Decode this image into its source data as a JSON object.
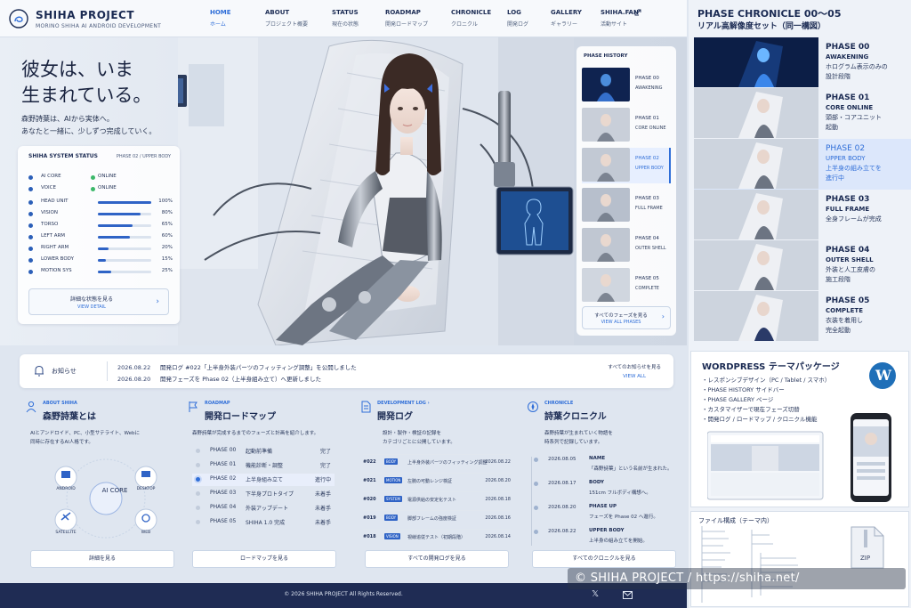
{
  "brand": {
    "name": "SHIHA PROJECT",
    "sub": "MORINO SHIHA AI ANDROID DEVELOPMENT"
  },
  "nav": [
    {
      "en": "HOME",
      "ja": "ホーム"
    },
    {
      "en": "ABOUT",
      "ja": "プロジェクト概要"
    },
    {
      "en": "STATUS",
      "ja": "現在の状態"
    },
    {
      "en": "ROADMAP",
      "ja": "開発ロードマップ"
    },
    {
      "en": "CHRONICLE",
      "ja": "クロニクル"
    },
    {
      "en": "LOG",
      "ja": "開発ログ"
    },
    {
      "en": "GALLERY",
      "ja": "ギャラリー"
    },
    {
      "en": "SHIHA.FAN",
      "ja": "活動サイト"
    }
  ],
  "hero": {
    "headline": "彼女は、いま\n生まれている。",
    "sub": "森野詩葉は、AIから実体へ。\nあなたと一緒に、少しずつ完成していく。"
  },
  "status": {
    "title": "SHIHA SYSTEM STATUS",
    "phase": "PHASE 02 / UPPER BODY",
    "online_rows": [
      {
        "name": "AI CORE",
        "value": "ONLINE"
      },
      {
        "name": "VOICE",
        "value": "ONLINE"
      }
    ],
    "rows": [
      {
        "name": "HEAD UNIT",
        "value": 100,
        "label": "100%"
      },
      {
        "name": "VISION",
        "value": 80,
        "label": "80%"
      },
      {
        "name": "TORSO",
        "value": 65,
        "label": "65%"
      },
      {
        "name": "LEFT ARM",
        "value": 60,
        "label": "60%"
      },
      {
        "name": "RIGHT ARM",
        "value": 20,
        "label": "20%"
      },
      {
        "name": "LOWER BODY",
        "value": 15,
        "label": "15%"
      },
      {
        "name": "MOTION SYS",
        "value": 25,
        "label": "25%"
      }
    ],
    "btn_ja": "詳細な状態を見る",
    "btn_en": "VIEW DETAIL"
  },
  "phase_history": {
    "title": "PHASE HISTORY",
    "items": [
      {
        "p": "PHASE 00",
        "n": "AWAKENING"
      },
      {
        "p": "PHASE 01",
        "n": "CORE ONLINE"
      },
      {
        "p": "PHASE 02",
        "n": "UPPER BODY"
      },
      {
        "p": "PHASE 03",
        "n": "FULL FRAME"
      },
      {
        "p": "PHASE 04",
        "n": "OUTER SHELL"
      },
      {
        "p": "PHASE 05",
        "n": "COMPLETE"
      }
    ],
    "btn_ja": "すべてのフェーズを見る",
    "btn_en": "VIEW ALL PHASES"
  },
  "notice": {
    "label": "お知らせ",
    "items": [
      {
        "date": "2026.08.22",
        "text": "開発ログ #022「上半身外装パーツのフィッティング調整」を公開しました"
      },
      {
        "date": "2026.08.20",
        "text": "開発フェーズを Phase 02（上半身組み立て）へ更新しました"
      }
    ],
    "all_ja": "すべてのお知らせを見る",
    "all_en": "VIEW ALL"
  },
  "about": {
    "en": "ABOUT SHIHA",
    "ja": "森野詩葉とは",
    "desc": "AIとアンドロイド、PC、小型サテライト、Webに\n同時に存在するAI人格です。",
    "core": "AI CORE",
    "nodes": [
      "ANDROID",
      "DESKTOP",
      "SATELLITE",
      "WEB"
    ],
    "btn": "詳細を見る"
  },
  "roadmap": {
    "en": "ROADMAP",
    "ja": "開発ロードマップ",
    "desc": "森野詩葉が完成するまでのフェーズと計画を紹介します。",
    "rows": [
      {
        "p": "PHASE 00",
        "n": "起動前準備",
        "s": "完了"
      },
      {
        "p": "PHASE 01",
        "n": "機能診断・調整",
        "s": "完了"
      },
      {
        "p": "PHASE 02",
        "n": "上半身組み立て",
        "s": "進行中"
      },
      {
        "p": "PHASE 03",
        "n": "下半身プロトタイプ",
        "s": "未着手"
      },
      {
        "p": "PHASE 04",
        "n": "外装アップデート",
        "s": "未着手"
      },
      {
        "p": "PHASE 05",
        "n": "SHIHA 1.0 完成",
        "s": "未着手"
      }
    ],
    "btn": "ロードマップを見る"
  },
  "devlog": {
    "en": "DEVELOPMENT LOG ›",
    "ja": "開発ログ",
    "desc": "設計・製作・検証の記録を\nカテゴリごとに公開しています。",
    "rows": [
      {
        "num": "#022",
        "tag": "BODY",
        "t": "上半身外装パーツのフィッティング調整",
        "d": "2026.08.22"
      },
      {
        "num": "#021",
        "tag": "MOTION",
        "t": "左腕の可動レンジ検証",
        "d": "2026.08.20"
      },
      {
        "num": "#020",
        "tag": "SYSTEM",
        "t": "電源供給の安定化テスト",
        "d": "2026.08.18"
      },
      {
        "num": "#019",
        "tag": "BODY",
        "t": "脚部フレームの強度検証",
        "d": "2026.08.16"
      },
      {
        "num": "#018",
        "tag": "VISION",
        "t": "視線追従テスト（初期段階）",
        "d": "2026.08.14"
      }
    ],
    "btn": "すべての開発ログを見る"
  },
  "chronicle": {
    "en": "CHRONICLE",
    "ja": "詩葉クロニクル",
    "desc": "森野詩葉が生まれていく物語を\n時系列で記録しています。",
    "rows": [
      {
        "d": "2026.08.05",
        "n": "NAME",
        "x": "「森野詩葉」という名前が生まれた。"
      },
      {
        "d": "2026.08.17",
        "n": "BODY",
        "x": "151cm フルボディ構想へ。"
      },
      {
        "d": "2026.08.20",
        "n": "PHASE UP",
        "x": "フェーズを Phase 02 へ進行。"
      },
      {
        "d": "2026.08.22",
        "n": "UPPER BODY",
        "x": "上半身の組み立てを開始。"
      }
    ],
    "btn": "すべてのクロニクルを見る"
  },
  "footer": {
    "copyright": "© 2026 SHIHA PROJECT All Rights Reserved."
  },
  "right": {
    "title1": "PHASE CHRONICLE 00〜05",
    "title2": "リアル高解像度セット（同一構図）",
    "phases": [
      {
        "p": "PHASE 00",
        "n": "AWAKENING",
        "d": "ホログラム表示のみの\n設計段階"
      },
      {
        "p": "PHASE 01",
        "n": "CORE ONLINE",
        "d": "頭部・コアユニット\n起動"
      },
      {
        "p": "PHASE 02",
        "n": "UPPER BODY",
        "d": "上半身の組み立てを\n進行中"
      },
      {
        "p": "PHASE 03",
        "n": "FULL FRAME",
        "d": "全身フレームが完成"
      },
      {
        "p": "PHASE 04",
        "n": "OUTER SHELL",
        "d": "外装と人工皮膚の\n施工段階"
      },
      {
        "p": "PHASE 05",
        "n": "COMPLETE",
        "d": "衣装を着用し\n完全起動"
      }
    ],
    "wp_title": "WORDPRESS テーマパッケージ",
    "wp_items": [
      "・レスポンシブデザイン（PC / Tablet / スマホ）",
      "・PHASE HISTORY サイドバー",
      "・PHASE GALLERY ページ",
      "・カスタマイザーで現在フェーズ切替",
      "・開発ログ / ロードマップ / クロニクル機能"
    ],
    "files_title": "ファイル構成（テーマ内）",
    "zip": "ZIP"
  },
  "watermark": "© SHIHA PROJECT / https://shiha.net/"
}
